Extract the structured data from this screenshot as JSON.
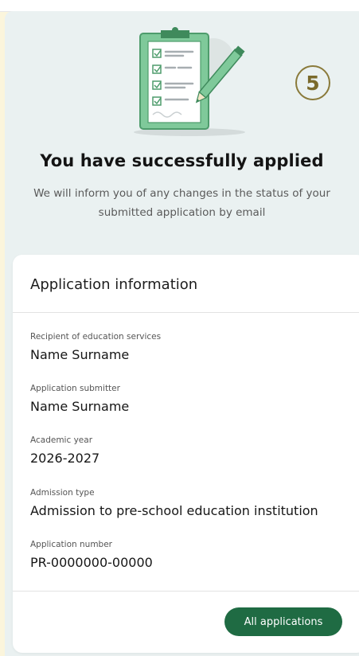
{
  "hero": {
    "step_number": "5",
    "title": "You have successfully applied",
    "subtitle": "We will inform you of any changes in the status of your submitted application by email"
  },
  "card": {
    "title": "Application information",
    "fields": [
      {
        "label": "Recipient of education services",
        "value": "Name Surname"
      },
      {
        "label": "Application submitter",
        "value": "Name Surname"
      },
      {
        "label": "Academic year",
        "value": "2026-2027"
      },
      {
        "label": "Admission type",
        "value": "Admission to pre-school education institution"
      },
      {
        "label": "Application number",
        "value": "PR-0000000-00000"
      }
    ],
    "button_label": "All applications"
  },
  "colors": {
    "accent": "#1f6b43",
    "page_background": "#fbf5dc",
    "panel_background": "#eaf1f1",
    "badge": "#7a6a2b"
  },
  "icons": {
    "illustration": "clipboard-checklist-pencil",
    "badge": "step-number-badge"
  }
}
